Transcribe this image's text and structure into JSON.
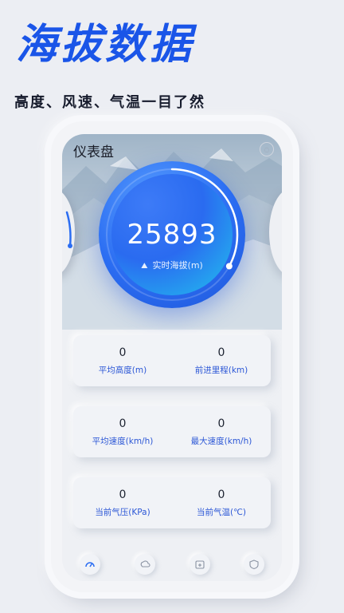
{
  "promo": {
    "headline": "海拔数据",
    "subheadline": "高度、风速、气温一目了然"
  },
  "app": {
    "title": "仪表盘"
  },
  "gauge": {
    "value": "25893",
    "label": "实时海拔(m)",
    "progress_fraction": 0.33,
    "icon": "altitude-icon"
  },
  "stats": [
    {
      "left": {
        "value": "0",
        "label": "平均高度(m)"
      },
      "right": {
        "value": "0",
        "label": "前进里程(km)"
      }
    },
    {
      "left": {
        "value": "0",
        "label": "平均速度(km/h)"
      },
      "right": {
        "value": "0",
        "label": "最大速度(km/h)"
      }
    },
    {
      "left": {
        "value": "0",
        "label": "当前气压(KPa)"
      },
      "right": {
        "value": "0",
        "label": "当前气温(℃)"
      }
    }
  ],
  "tabbar": {
    "items": [
      {
        "icon": "speedometer-icon",
        "active": true
      },
      {
        "icon": "weather-icon",
        "active": false
      },
      {
        "icon": "calendar-icon",
        "active": false
      },
      {
        "icon": "shield-icon",
        "active": false
      }
    ]
  },
  "colors": {
    "accent": "#1a55e8",
    "stat_label": "#2c57d6",
    "gauge_inner_start": "#2a6bf0",
    "gauge_inner_end": "#21c2ee"
  }
}
